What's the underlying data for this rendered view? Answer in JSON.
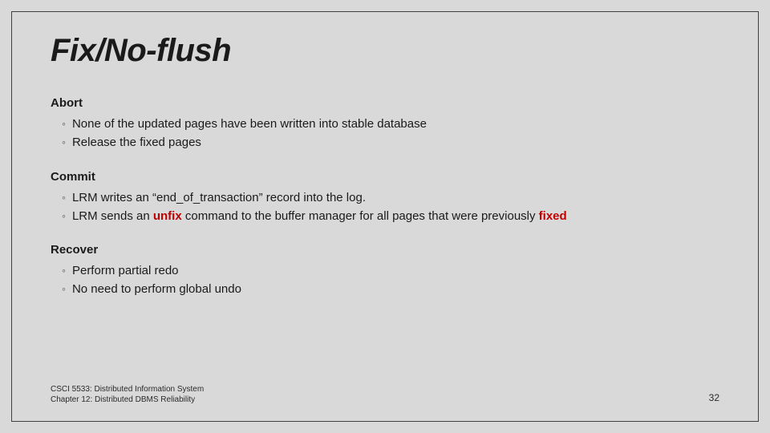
{
  "title": "Fix/No-flush",
  "sections": {
    "abort": {
      "heading": "Abort",
      "items": [
        "None of the updated pages have been written into stable database",
        "Release the fixed pages"
      ]
    },
    "commit": {
      "heading": "Commit",
      "item1_pre": "LRM writes an “end_of_transaction” record into the log.",
      "item2_pre": "LRM sends an ",
      "item2_em1": "unfix",
      "item2_mid": " command to the buffer manager for all pages that were previously ",
      "item2_em2": "fixed"
    },
    "recover": {
      "heading": "Recover",
      "items": [
        "Perform partial redo",
        "No need to perform global undo"
      ]
    }
  },
  "footer": {
    "line1": "CSCI 5533: Distributed Information System",
    "line2": "Chapter 12: Distributed DBMS Reliability"
  },
  "page_number": "32"
}
